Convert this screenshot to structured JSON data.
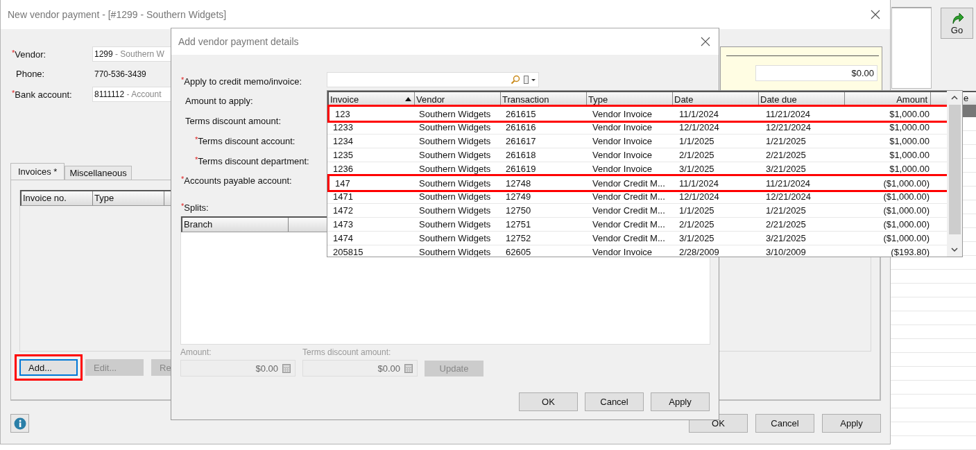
{
  "background_app": {
    "go_button": "Go",
    "grid_header": "e"
  },
  "window": {
    "title": "New vendor payment - [#1299 - Southern Widgets]",
    "fields": [
      {
        "marker": "*",
        "label": "Vendor:",
        "kind": "lookup",
        "value": "1299",
        "description": "- Southern W"
      },
      {
        "label": "Phone:",
        "kind": "text",
        "value": "770-536-3439"
      },
      {
        "marker": "*",
        "label": "Bank account:",
        "kind": "lookup",
        "value": "8111112",
        "description": "- Account"
      }
    ],
    "summary_panel": {
      "value": "$0.00"
    },
    "tabs": [
      {
        "label": "Invoices *",
        "selected": true
      },
      {
        "label": "Miscellaneous",
        "selected": false
      }
    ],
    "invoice_table": {
      "columns": [
        "Invoice no.",
        "Type"
      ]
    },
    "tab_buttons": [
      {
        "label": "Add...",
        "disabled": false,
        "focused": true,
        "highlighted": true
      },
      {
        "label": "Edit...",
        "disabled": true,
        "focused": false,
        "highlighted": false
      },
      {
        "label": "Re",
        "disabled": true,
        "focused": false,
        "highlighted": false
      }
    ],
    "buttons": [
      "OK",
      "Cancel",
      "Apply"
    ]
  },
  "dialog": {
    "title": "Add vendor payment details",
    "fields": [
      {
        "marker": "*",
        "label": "Apply to credit memo/invoice:",
        "indented": false
      },
      {
        "label": "Amount to apply:",
        "indented": false
      },
      {
        "label": "Terms discount amount:",
        "indented": false
      },
      {
        "marker": "*",
        "label": "Terms discount account:",
        "indented": true
      },
      {
        "marker": "*",
        "label": "Terms discount department:",
        "indented": true
      },
      {
        "marker": "*",
        "label": "Accounts payable account:",
        "indented": false
      }
    ],
    "splits": {
      "marker": "*",
      "label": "Splits:",
      "columns": [
        "Branch"
      ]
    },
    "amount_fields": [
      {
        "label": "Amount:",
        "value": "$0.00",
        "disabled": true
      },
      {
        "label": "Terms discount amount:",
        "value": "$0.00",
        "disabled": true
      }
    ],
    "update_button": {
      "label": "Update",
      "disabled": true
    },
    "buttons": [
      "OK",
      "Cancel",
      "Apply"
    ]
  },
  "dropdown": {
    "columns": [
      {
        "label": "Invoice",
        "sorted": true,
        "kind": "text"
      },
      {
        "label": "Vendor",
        "sorted": false,
        "kind": "text"
      },
      {
        "label": "Transaction",
        "sorted": false,
        "kind": "text"
      },
      {
        "label": "Type",
        "sorted": false,
        "kind": "text"
      },
      {
        "label": "Date",
        "sorted": false,
        "kind": "text"
      },
      {
        "label": "Date due",
        "sorted": false,
        "kind": "text"
      },
      {
        "label": "Amount",
        "sorted": false,
        "kind": "money"
      }
    ],
    "rows": [
      {
        "cells": [
          "123",
          "Southern Widgets",
          "261615",
          "Vendor Invoice",
          "11/1/2024",
          "11/21/2024",
          "$1,000.00"
        ],
        "highlighted": true
      },
      {
        "cells": [
          "1233",
          "Southern Widgets",
          "261616",
          "Vendor Invoice",
          "12/1/2024",
          "12/21/2024",
          "$1,000.00"
        ],
        "highlighted": false
      },
      {
        "cells": [
          "1234",
          "Southern Widgets",
          "261617",
          "Vendor Invoice",
          "1/1/2025",
          "1/21/2025",
          "$1,000.00"
        ],
        "highlighted": false
      },
      {
        "cells": [
          "1235",
          "Southern Widgets",
          "261618",
          "Vendor Invoice",
          "2/1/2025",
          "2/21/2025",
          "$1,000.00"
        ],
        "highlighted": false
      },
      {
        "cells": [
          "1236",
          "Southern Widgets",
          "261619",
          "Vendor Invoice",
          "3/1/2025",
          "3/21/2025",
          "$1,000.00"
        ],
        "highlighted": false
      },
      {
        "cells": [
          "147",
          "Southern Widgets",
          "12748",
          "Vendor Credit M...",
          "11/1/2024",
          "11/21/2024",
          "($1,000.00)"
        ],
        "highlighted": true
      },
      {
        "cells": [
          "1471",
          "Southern Widgets",
          "12749",
          "Vendor Credit M...",
          "12/1/2024",
          "12/21/2024",
          "($1,000.00)"
        ],
        "highlighted": false
      },
      {
        "cells": [
          "1472",
          "Southern Widgets",
          "12750",
          "Vendor Credit M...",
          "1/1/2025",
          "1/21/2025",
          "($1,000.00)"
        ],
        "highlighted": false
      },
      {
        "cells": [
          "1473",
          "Southern Widgets",
          "12751",
          "Vendor Credit M...",
          "2/1/2025",
          "2/21/2025",
          "($1,000.00)"
        ],
        "highlighted": false
      },
      {
        "cells": [
          "1474",
          "Southern Widgets",
          "12752",
          "Vendor Credit M...",
          "3/1/2025",
          "3/21/2025",
          "($1,000.00)"
        ],
        "highlighted": false
      },
      {
        "cells": [
          "205815",
          "Southern Widgets",
          "62605",
          "Vendor Invoice",
          "2/28/2009",
          "3/10/2009",
          "($193.80)"
        ],
        "highlighted": false
      }
    ]
  }
}
